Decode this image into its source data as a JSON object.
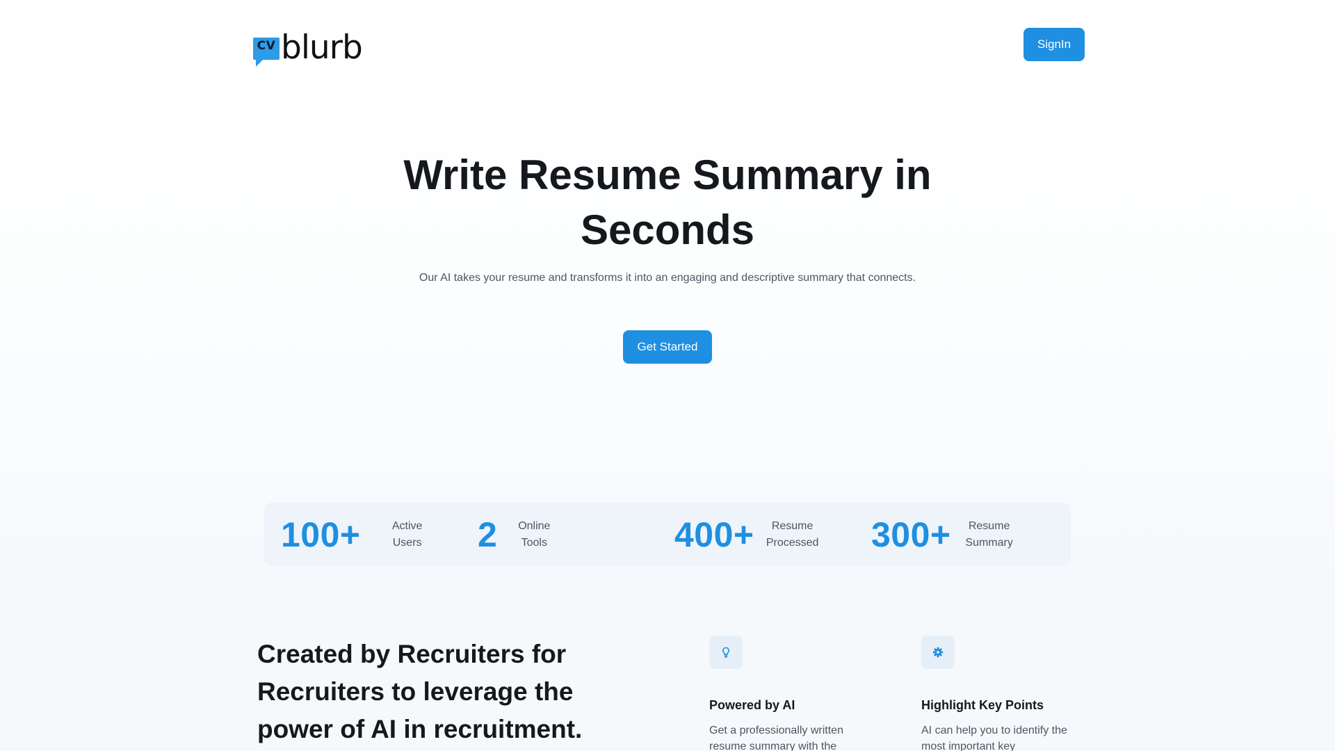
{
  "header": {
    "logo_badge_text": "CV",
    "logo_word": "blurb",
    "signin_label": "SignIn"
  },
  "hero": {
    "title": "Write Resume Summary in Seconds",
    "subtitle": "Our AI takes your resume and transforms it into an engaging and descriptive summary that connects.",
    "cta_label": "Get Started"
  },
  "stats": [
    {
      "number": "100+",
      "label_line1": "Active",
      "label_line2": "Users"
    },
    {
      "number": "2",
      "label_line1": "Online",
      "label_line2": "Tools"
    },
    {
      "number": "400+",
      "label_line1": "Resume",
      "label_line2": "Processed"
    },
    {
      "number": "300+",
      "label_line1": "Resume",
      "label_line2": "Summary"
    }
  ],
  "about": {
    "title": "Created by Recruiters for Recruiters to leverage the power of AI in recruitment."
  },
  "features": [
    {
      "icon": "lightbulb-icon",
      "title": "Powered by AI",
      "text": "Get a professionally written resume summary with the"
    },
    {
      "icon": "gear-icon",
      "title": "Highlight Key Points",
      "text": "AI can help you to identify the most important key"
    }
  ],
  "colors": {
    "accent": "#1e8fe1",
    "logo_badge": "#2c9be8",
    "stats_bg": "#eef4fa",
    "text_dark": "#15191d",
    "text_muted": "#4c5560"
  }
}
